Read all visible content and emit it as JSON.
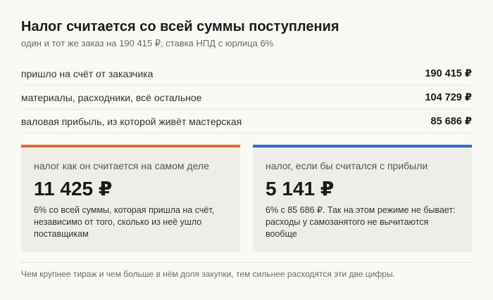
{
  "header": {
    "title": "Налог считается со всей суммы поступления",
    "subtitle": "один и тот же заказ на 190 415 ₽, ставка НПД с юрлица 6%"
  },
  "rows": [
    {
      "label": "пришло на счёт от заказчика",
      "value": "190 415 ₽"
    },
    {
      "label": "материалы, расходники, всё остальное",
      "value": "104 729 ₽"
    },
    {
      "label": "валовая прибыль, из которой живёт мастерская",
      "value": "85 686 ₽"
    }
  ],
  "cards": [
    {
      "label": "налог как он считается на самом деле",
      "amount": "11 425 ₽",
      "note": "6% со всей суммы, которая пришла на счёт, независимо от того, сколько из неё ушло поставщикам",
      "accent": "#e0683a"
    },
    {
      "label": "налог, если бы считался с прибыли",
      "amount": "5 141 ₽",
      "note": "6% с 85 686 ₽. Так на этом режиме не бывает: расходы у самозанятого не вычитаются вообще",
      "accent": "#2c6fd0"
    }
  ],
  "footnote": "Чем крупнее тираж и чем больше в нём доля закупки, тем сильнее расходятся эти две цифры."
}
